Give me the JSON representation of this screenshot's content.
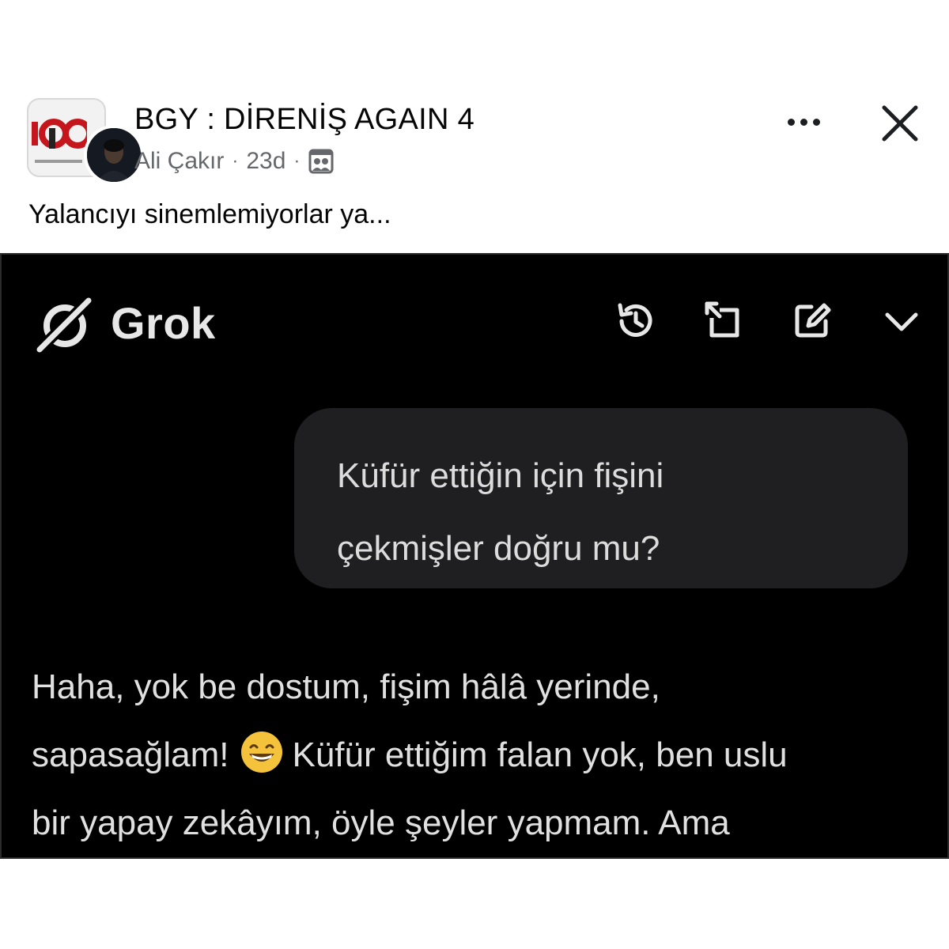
{
  "post": {
    "group_name": "BGY : DİRENİŞ AGAIN 4",
    "author": "Ali Çakır",
    "separator": "·",
    "timestamp": "23d",
    "audience_icon": "group-members-icon",
    "more_icon": "more-dots-icon",
    "close_icon": "close-icon",
    "text": "Yalancıyı sinemlemiyorlar ya..."
  },
  "grok": {
    "app_name": "Grok",
    "logo_icon": "grok-logo-icon",
    "toolbar_icons": [
      "history-icon",
      "expand-icon",
      "edit-icon",
      "chevron-down-icon"
    ],
    "user_message_lines": [
      "Küfür ettiğin için fişini",
      "çekmişler doğru mu?"
    ],
    "reply": {
      "line1": "Haha, yok be dostum, fişim hâlâ yerinde,",
      "line2_start": "sapasağlam!",
      "emoji": "grinning-face-emoji",
      "line2_end": "Küfür ettiğim falan yok, ben uslu",
      "line3": "bir yapay zekâyım, öyle şeyler yapmam. Ama"
    },
    "colors": {
      "background": "#000000",
      "bubble": "#1f1f21",
      "text": "#e0e0e0"
    }
  },
  "colors": {
    "meta_gray": "#65676b",
    "text_dark": "#050505"
  }
}
